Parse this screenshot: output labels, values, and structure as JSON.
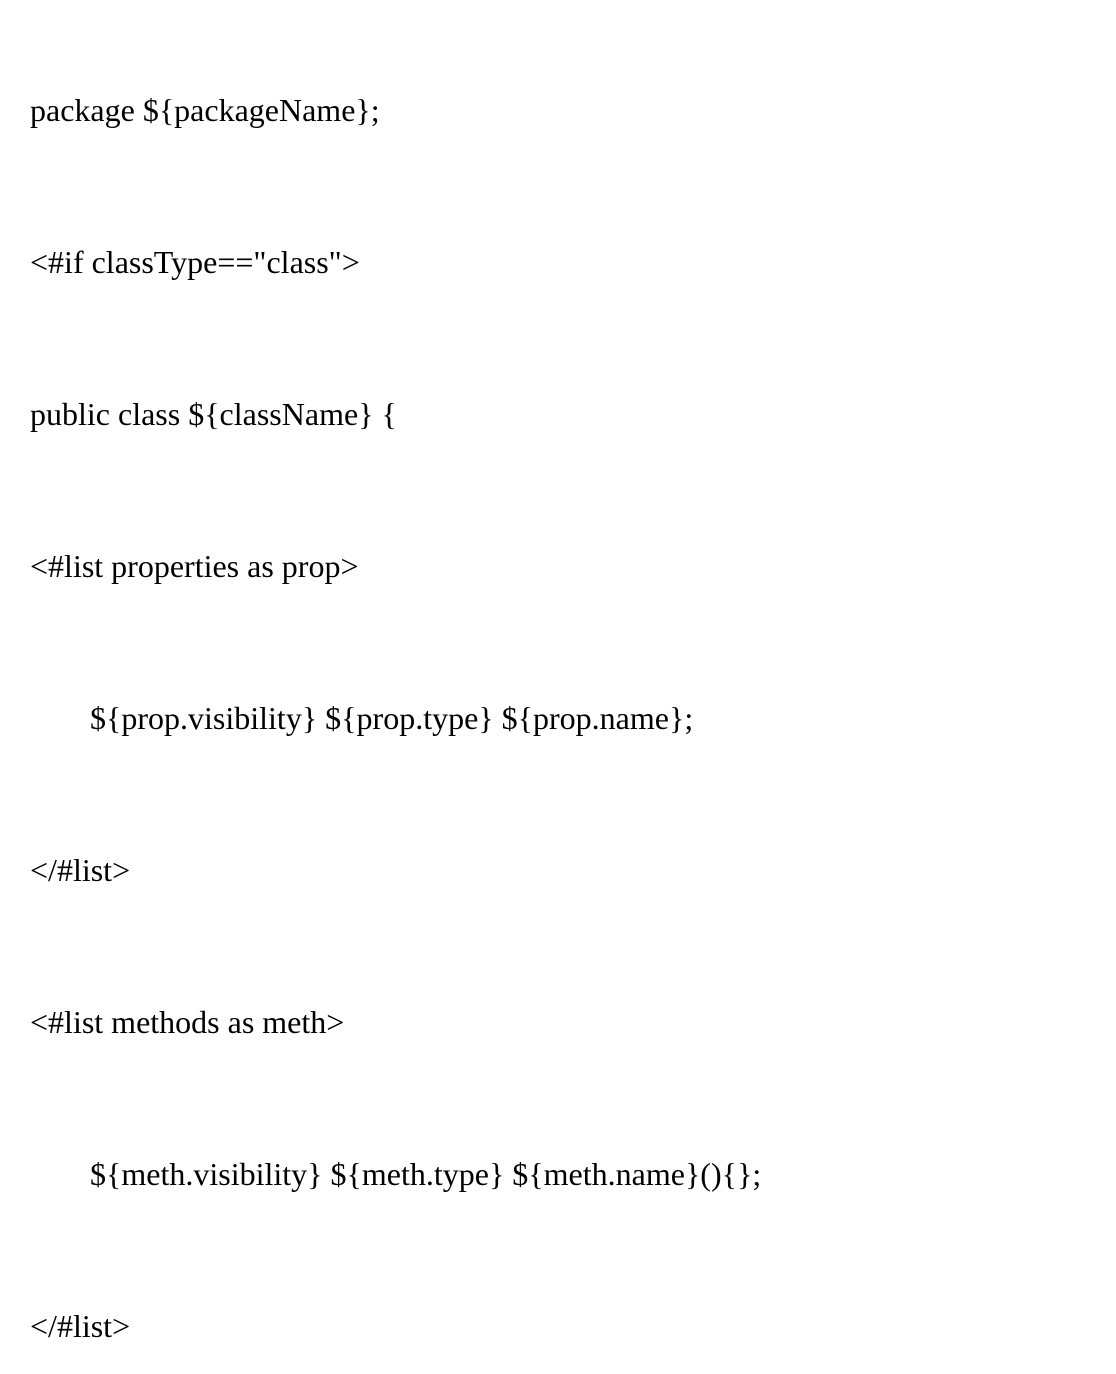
{
  "code": {
    "line1": "package ${packageName};",
    "line2": "<#if classType==\"class\">",
    "line3": "public class ${className} {",
    "line4": "<#list properties as prop>",
    "line5": "${prop.visibility} ${prop.type} ${prop.name};",
    "line6": "</#list>",
    "line7": "<#list methods as meth>",
    "line8": "${meth.visibility} ${meth.type} ${meth.name}(){};",
    "line9": "</#list>"
  }
}
